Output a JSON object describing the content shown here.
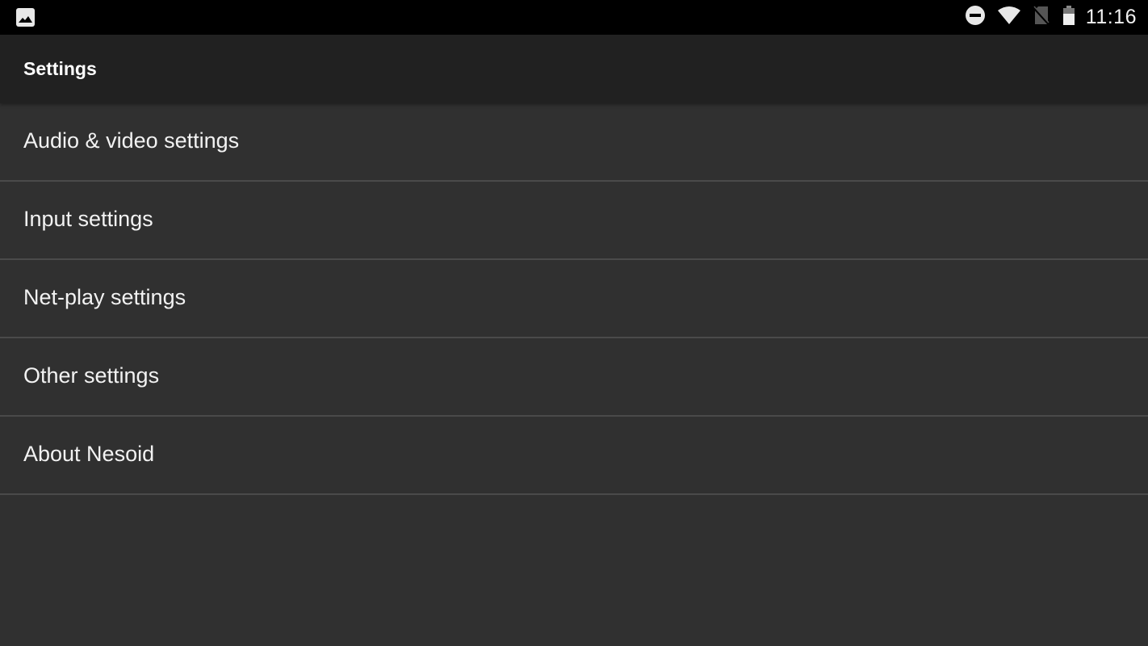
{
  "status_bar": {
    "left_icon": "image-icon",
    "icons": [
      "do-not-disturb-icon",
      "wifi-icon",
      "no-sim-icon",
      "battery-icon"
    ],
    "time": "11:16"
  },
  "app_bar": {
    "title": "Settings"
  },
  "settings": {
    "items": [
      {
        "label": "Audio & video settings"
      },
      {
        "label": "Input settings"
      },
      {
        "label": "Net-play settings"
      },
      {
        "label": "Other settings"
      },
      {
        "label": "About Nesoid"
      }
    ]
  },
  "colors": {
    "status_bar_bg": "#000000",
    "app_bar_bg": "#212121",
    "list_bg": "#303030",
    "divider": "#4a4a4a",
    "text": "#ffffff"
  }
}
